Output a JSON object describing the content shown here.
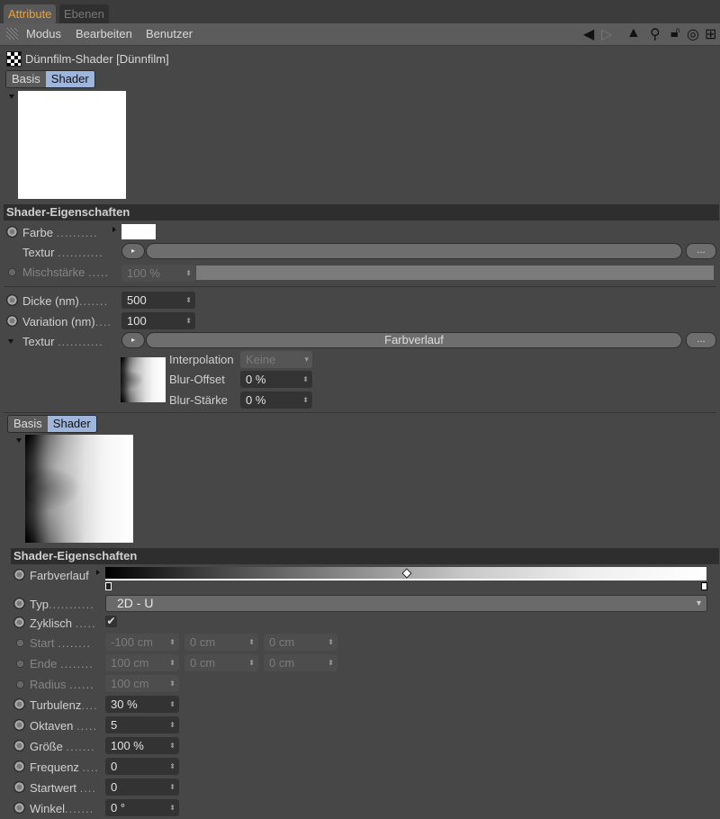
{
  "tabs": [
    {
      "label": "Attribute",
      "active": true
    },
    {
      "label": "Ebenen",
      "active": false
    }
  ],
  "menu": {
    "items": [
      "Modus",
      "Bearbeiten",
      "Benutzer"
    ],
    "tool_icons": [
      "arrow-left-icon",
      "arrow-right-icon",
      "arrow-up-icon",
      "search-icon",
      "lock-icon",
      "target-icon",
      "new-panel-icon"
    ]
  },
  "object": {
    "title": "Dünnfilm-Shader [Dünnfilm]",
    "icon": "checker-icon"
  },
  "top_subtabs": [
    {
      "label": "Basis",
      "selected": false
    },
    {
      "label": "Shader",
      "selected": true
    }
  ],
  "section1": {
    "header": "Shader-Eigenschaften",
    "farbe": {
      "label": "Farbe",
      "color": "#ffffff"
    },
    "textur": {
      "label": "Textur",
      "value": "",
      "more": "..."
    },
    "mischstaerke": {
      "label": "Mischstärke",
      "value": "100 %",
      "percent": 100
    }
  },
  "section2": {
    "dicke": {
      "label": "Dicke (nm)",
      "value": "500"
    },
    "variation": {
      "label": "Variation (nm)",
      "value": "100"
    },
    "textur": {
      "label": "Textur",
      "value": "Farbverlauf",
      "more": "..."
    },
    "interpolation": {
      "label": "Interpolation",
      "value": "Keine"
    },
    "blur_offset": {
      "label": "Blur-Offset",
      "value": "0 %"
    },
    "blur_staerke": {
      "label": "Blur-Stärke",
      "value": "0 %"
    }
  },
  "sub_subtabs": [
    {
      "label": "Basis",
      "selected": false
    },
    {
      "label": "Shader",
      "selected": true
    }
  ],
  "section3": {
    "header": "Shader-Eigenschaften",
    "farbverlauf": {
      "label": "Farbverlauf",
      "start_color": "#000000",
      "end_color": "#ffffff",
      "midpoint": 0.5
    },
    "typ": {
      "label": "Typ",
      "value": "2D - U"
    },
    "zyklisch": {
      "label": "Zyklisch",
      "checked": true,
      "mark": "✔"
    },
    "start": {
      "label": "Start",
      "values": [
        "-100 cm",
        "0 cm",
        "0 cm"
      ]
    },
    "ende": {
      "label": "Ende",
      "values": [
        "100 cm",
        "0 cm",
        "0 cm"
      ]
    },
    "radius": {
      "label": "Radius",
      "value": "100 cm"
    },
    "turbulenz": {
      "label": "Turbulenz",
      "value": "30 %"
    },
    "oktaven": {
      "label": "Oktaven",
      "value": "5"
    },
    "groesse": {
      "label": "Größe",
      "value": "100 %"
    },
    "frequenz": {
      "label": "Frequenz",
      "value": "0"
    },
    "startwert": {
      "label": "Startwert",
      "value": "0"
    },
    "winkel": {
      "label": "Winkel",
      "value": "0 °"
    }
  }
}
